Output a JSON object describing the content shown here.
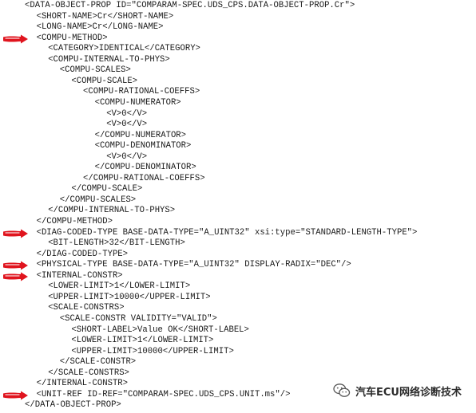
{
  "colors": {
    "text": "#1a1a1a",
    "arrow": "#e0141e",
    "background": "#ffffff"
  },
  "xml_lines": [
    {
      "indent": 0,
      "text": "<DATA-OBJECT-PROP ID=\"COMPARAM-SPEC.UDS_CPS.DATA-OBJECT-PROP.Cr\">",
      "marked": false
    },
    {
      "indent": 1,
      "text": "<SHORT-NAME>Cr</SHORT-NAME>",
      "marked": false
    },
    {
      "indent": 1,
      "text": "<LONG-NAME>Cr</LONG-NAME>",
      "marked": false
    },
    {
      "indent": 1,
      "text": "<COMPU-METHOD>",
      "marked": true
    },
    {
      "indent": 2,
      "text": "<CATEGORY>IDENTICAL</CATEGORY>",
      "marked": false
    },
    {
      "indent": 2,
      "text": "<COMPU-INTERNAL-TO-PHYS>",
      "marked": false
    },
    {
      "indent": 3,
      "text": "<COMPU-SCALES>",
      "marked": false
    },
    {
      "indent": 4,
      "text": "<COMPU-SCALE>",
      "marked": false
    },
    {
      "indent": 5,
      "text": "<COMPU-RATIONAL-COEFFS>",
      "marked": false
    },
    {
      "indent": 6,
      "text": "<COMPU-NUMERATOR>",
      "marked": false
    },
    {
      "indent": 7,
      "text": "<V>0</V>",
      "marked": false
    },
    {
      "indent": 7,
      "text": "<V>0</V>",
      "marked": false
    },
    {
      "indent": 6,
      "text": "</COMPU-NUMERATOR>",
      "marked": false
    },
    {
      "indent": 6,
      "text": "<COMPU-DENOMINATOR>",
      "marked": false
    },
    {
      "indent": 7,
      "text": "<V>0</V>",
      "marked": false
    },
    {
      "indent": 6,
      "text": "</COMPU-DENOMINATOR>",
      "marked": false
    },
    {
      "indent": 5,
      "text": "</COMPU-RATIONAL-COEFFS>",
      "marked": false
    },
    {
      "indent": 4,
      "text": "</COMPU-SCALE>",
      "marked": false
    },
    {
      "indent": 3,
      "text": "</COMPU-SCALES>",
      "marked": false
    },
    {
      "indent": 2,
      "text": "</COMPU-INTERNAL-TO-PHYS>",
      "marked": false
    },
    {
      "indent": 1,
      "text": "</COMPU-METHOD>",
      "marked": false
    },
    {
      "indent": 1,
      "text": "<DIAG-CODED-TYPE BASE-DATA-TYPE=\"A_UINT32\" xsi:type=\"STANDARD-LENGTH-TYPE\">",
      "marked": true
    },
    {
      "indent": 2,
      "text": "<BIT-LENGTH>32</BIT-LENGTH>",
      "marked": false
    },
    {
      "indent": 1,
      "text": "</DIAG-CODED-TYPE>",
      "marked": false
    },
    {
      "indent": 1,
      "text": "<PHYSICAL-TYPE BASE-DATA-TYPE=\"A_UINT32\" DISPLAY-RADIX=\"DEC\"/>",
      "marked": true
    },
    {
      "indent": 1,
      "text": "<INTERNAL-CONSTR>",
      "marked": true
    },
    {
      "indent": 2,
      "text": "<LOWER-LIMIT>1</LOWER-LIMIT>",
      "marked": false
    },
    {
      "indent": 2,
      "text": "<UPPER-LIMIT>10000</UPPER-LIMIT>",
      "marked": false
    },
    {
      "indent": 2,
      "text": "<SCALE-CONSTRS>",
      "marked": false
    },
    {
      "indent": 3,
      "text": "<SCALE-CONSTR VALIDITY=\"VALID\">",
      "marked": false
    },
    {
      "indent": 4,
      "text": "<SHORT-LABEL>Value OK</SHORT-LABEL>",
      "marked": false
    },
    {
      "indent": 4,
      "text": "<LOWER-LIMIT>1</LOWER-LIMIT>",
      "marked": false
    },
    {
      "indent": 4,
      "text": "<UPPER-LIMIT>10000</UPPER-LIMIT>",
      "marked": false
    },
    {
      "indent": 3,
      "text": "</SCALE-CONSTR>",
      "marked": false
    },
    {
      "indent": 2,
      "text": "</SCALE-CONSTRS>",
      "marked": false
    },
    {
      "indent": 1,
      "text": "</INTERNAL-CONSTR>",
      "marked": false
    },
    {
      "indent": 1,
      "text": "<UNIT-REF ID-REF=\"COMPARAM-SPEC.UDS_CPS.UNIT.ms\"/>",
      "marked": true
    },
    {
      "indent": 0,
      "text": "</DATA-OBJECT-PROP>",
      "marked": false
    }
  ],
  "watermark": {
    "icon": "wechat-icon",
    "text": "汽车ECU网络诊断技术"
  }
}
